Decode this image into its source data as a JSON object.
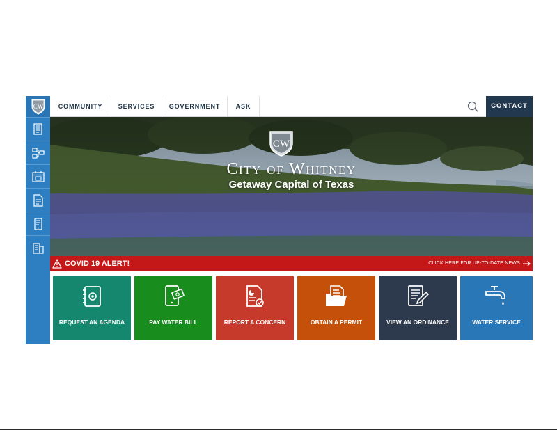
{
  "nav": {
    "items": [
      "COMMUNITY",
      "SERVICES",
      "GOVERNMENT",
      "ASK"
    ],
    "contact_label": "CONTACT"
  },
  "hero": {
    "title": "City of Whitney",
    "subtitle": "Getaway Capital of Texas",
    "logo_letters": "CW"
  },
  "alert": {
    "title": "COVID 19 ALERT!",
    "link": "CLICK HERE FOR UP-TO-DATE NEWS"
  },
  "tiles": [
    {
      "label": "REQUEST AN AGENDA",
      "color": "#15876e",
      "icon": "agenda-book-icon"
    },
    {
      "label": "PAY WATER BILL",
      "color": "#188c1c",
      "icon": "tablet-payment-icon"
    },
    {
      "label": "REPORT A CONCERN",
      "color": "#c63a2c",
      "icon": "report-document-icon"
    },
    {
      "label": "OBTAIN A PERMIT",
      "color": "#c4500a",
      "icon": "permit-folder-icon"
    },
    {
      "label": "VIEW AN ORDINANCE",
      "color": "#2d3a4d",
      "icon": "ordinance-pen-icon"
    },
    {
      "label": "WATER SERVICE",
      "color": "#2a77b8",
      "icon": "water-faucet-icon"
    }
  ],
  "colors": {
    "sidebar": "#2e7fc2",
    "nav_text": "#1f3549",
    "contact_bg": "#22384e",
    "alert_bg": "#c41717"
  },
  "sidebar": {
    "icons": [
      "document-list-icon",
      "flowchart-icon",
      "calendar-icon",
      "notes-icon",
      "tablet-icon",
      "building-icon"
    ]
  }
}
